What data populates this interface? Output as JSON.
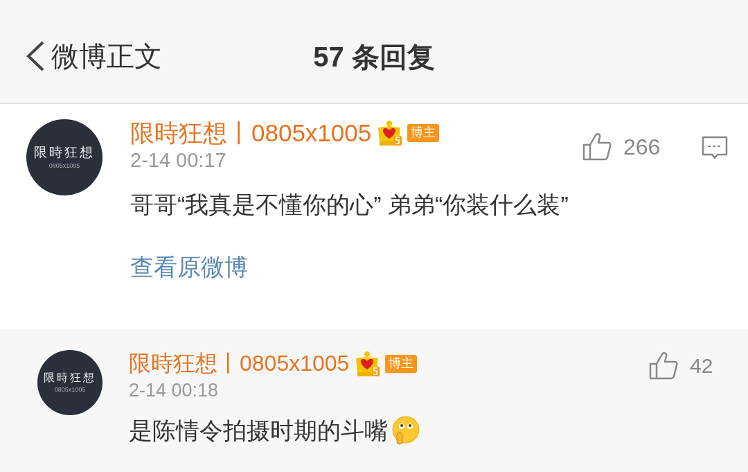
{
  "header": {
    "back_label": "微博正文",
    "title": "57 条回复"
  },
  "comments": [
    {
      "kind": "main",
      "avatar": {
        "title": "限時狂想",
        "subtitle": "0805x1005"
      },
      "author": "限時狂想丨0805x1005",
      "role_badge": "博主",
      "time": "2-14 00:17",
      "text": "哥哥“我真是不懂你的心” 弟弟“你装什么装”",
      "likes": "266",
      "link": "查看原微博",
      "emoji": false
    },
    {
      "kind": "reply",
      "avatar": {
        "title": "限時狂想",
        "subtitle": "0805x1005"
      },
      "author": "限時狂想丨0805x1005",
      "role_badge": "博主",
      "time": "2-14 00:18",
      "text": "是陈情令拍摄时期的斗嘴",
      "likes": "42",
      "emoji": true
    }
  ]
}
